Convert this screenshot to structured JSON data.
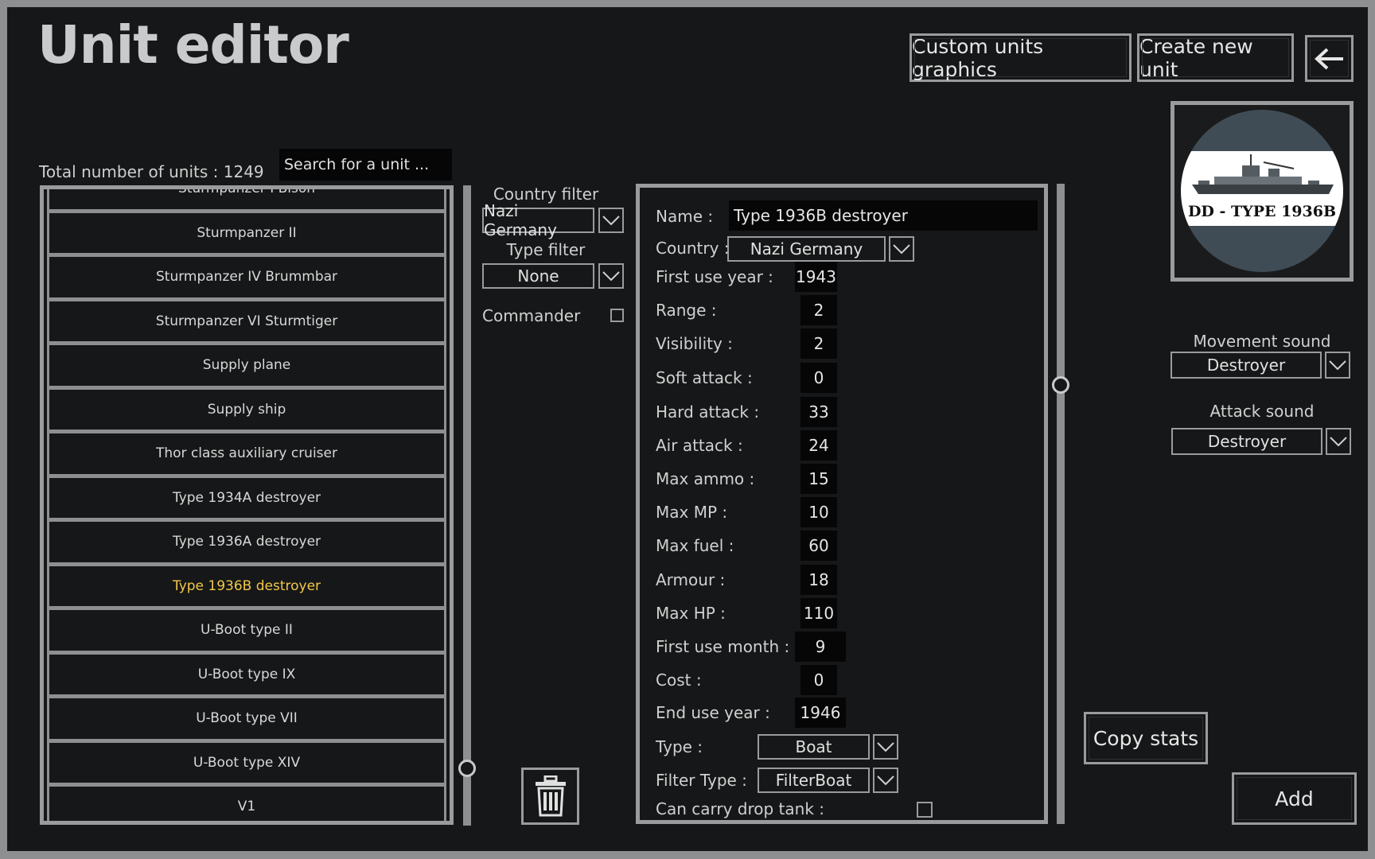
{
  "header": {
    "title": "Unit editor"
  },
  "toolbar": {
    "custom_graphics_label": "Custom units graphics",
    "create_unit_label": "Create new unit",
    "back_icon": "arrow-left-icon"
  },
  "list": {
    "total_label": "Total number of units : 1249",
    "search_placeholder": "Search for a unit ...",
    "items": [
      "Sturmpanzer I Bison",
      "Sturmpanzer II",
      "Sturmpanzer IV Brummbar",
      "Sturmpanzer VI Sturmtiger",
      "Supply plane",
      "Supply ship",
      "Thor class auxiliary cruiser",
      "Type 1934A destroyer",
      "Type 1936A destroyer",
      "Type 1936B destroyer",
      "U-Boot type II",
      "U-Boot type IX",
      "U-Boot type VII",
      "U-Boot type XIV",
      "V1"
    ],
    "selected_index": 9
  },
  "filters": {
    "country_label": "Country filter",
    "country_value": "Nazi Germany",
    "type_label": "Type filter",
    "type_value": "None",
    "commander_label": "Commander",
    "commander_checked": false,
    "delete_icon": "trash-icon"
  },
  "stats": {
    "name_label": "Name :",
    "name_value": "Type 1936B destroyer",
    "country_label": "Country :",
    "country_value": "Nazi Germany",
    "first_use_year_label": "First use year :",
    "first_use_year": "1943",
    "range_label": "Range :",
    "range": "2",
    "visibility_label": "Visibility :",
    "visibility": "2",
    "soft_attack_label": "Soft attack :",
    "soft_attack": "0",
    "hard_attack_label": "Hard attack :",
    "hard_attack": "33",
    "air_attack_label": "Air attack :",
    "air_attack": "24",
    "max_ammo_label": "Max ammo :",
    "max_ammo": "15",
    "max_mp_label": "Max MP :",
    "max_mp": "10",
    "max_fuel_label": "Max fuel :",
    "max_fuel": "60",
    "armour_label": "Armour :",
    "armour": "18",
    "max_hp_label": "Max HP :",
    "max_hp": "110",
    "first_use_month_label": "First use month :",
    "first_use_month": "9",
    "cost_label": "Cost :",
    "cost": "0",
    "end_use_year_label": "End use year :",
    "end_use_year": "1946",
    "type_label": "Type :",
    "type_value": "Boat",
    "filter_type_label": "Filter Type :",
    "filter_type_value": "FilterBoat",
    "drop_tank_label": "Can carry drop tank :"
  },
  "portrait": {
    "caption": "DD - TYPE 1936B"
  },
  "sounds": {
    "movement_label": "Movement sound",
    "movement_value": "Destroyer",
    "attack_label": "Attack sound",
    "attack_value": "Destroyer"
  },
  "actions": {
    "copy_stats_label": "Copy stats",
    "add_label": "Add"
  },
  "colors": {
    "background": "#161718",
    "border": "#9a9b9d",
    "selected_text": "#f0c84a",
    "field_bg": "#060607"
  }
}
